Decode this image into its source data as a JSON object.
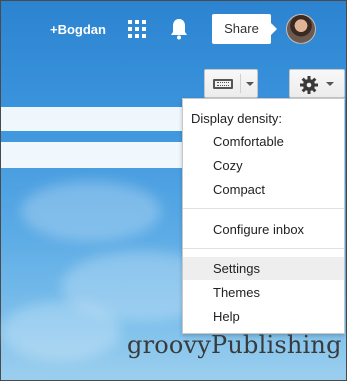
{
  "header": {
    "user_link": "+Bogdan",
    "share_label": "Share",
    "icons": {
      "apps": "apps-grid-icon",
      "notifications": "bell-icon",
      "account": "avatar"
    }
  },
  "toolbar": {
    "input_tools": "keyboard-icon",
    "settings": "gear-icon"
  },
  "menu": {
    "heading": "Display density:",
    "density_options": [
      {
        "label": "Comfortable",
        "checked": false
      },
      {
        "label": "Cozy",
        "checked": true
      },
      {
        "label": "Compact",
        "checked": false
      }
    ],
    "check_mark": "✓",
    "configure_inbox": "Configure inbox",
    "settings": "Settings",
    "themes": "Themes",
    "help": "Help"
  },
  "watermark": "groovyPublishing",
  "colors": {
    "topbar_bg": "#2c84d1",
    "menu_bg": "#ffffff",
    "menu_hover": "#eeeeee"
  }
}
